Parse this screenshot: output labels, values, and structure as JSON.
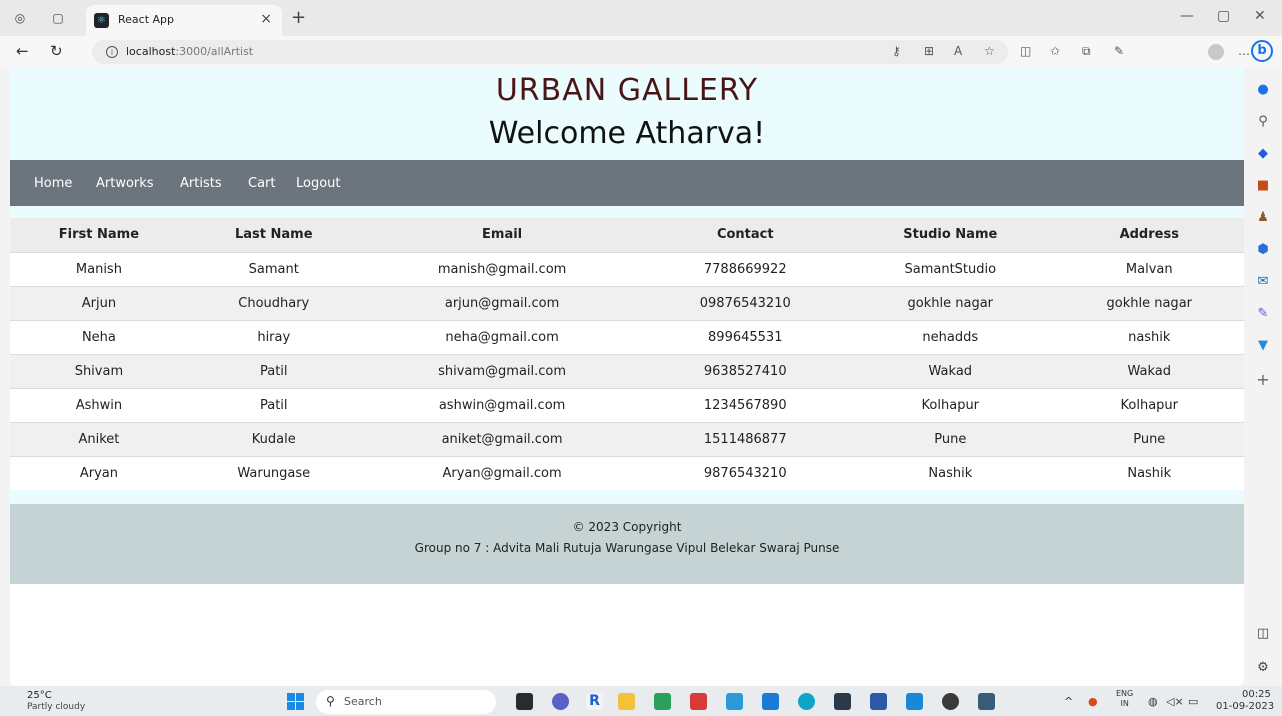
{
  "browser": {
    "tab_title": "React App",
    "url_host": "localhost",
    "url_path": ":3000/allArtist"
  },
  "page": {
    "brand": "URBAN GALLERY",
    "welcome": "Welcome Atharva!",
    "nav": [
      "Home",
      "Artworks",
      "Artists",
      "Cart",
      "Logout"
    ],
    "table": {
      "headers": [
        "First Name",
        "Last Name",
        "Email",
        "Contact",
        "Studio Name",
        "Address"
      ],
      "rows": [
        [
          "Manish",
          "Samant",
          "manish@gmail.com",
          "7788669922",
          "SamantStudio",
          "Malvan"
        ],
        [
          "Arjun",
          "Choudhary",
          "arjun@gmail.com",
          "09876543210",
          "gokhle nagar",
          "gokhle nagar"
        ],
        [
          "Neha",
          "hiray",
          "neha@gmail.com",
          "899645531",
          "nehadds",
          "nashik"
        ],
        [
          "Shivam",
          "Patil",
          "shivam@gmail.com",
          "9638527410",
          "Wakad",
          "Wakad"
        ],
        [
          "Ashwin",
          "Patil",
          "ashwin@gmail.com",
          "1234567890",
          "Kolhapur",
          "Kolhapur"
        ],
        [
          "Aniket",
          "Kudale",
          "aniket@gmail.com",
          "1511486877",
          "Pune",
          "Pune"
        ],
        [
          "Aryan",
          "Warungase",
          "Aryan@gmail.com",
          "9876543210",
          "Nashik",
          "Nashik"
        ]
      ]
    },
    "footer": {
      "copyright": "© 2023 Copyright",
      "group": "Group no 7 : Advita Mali Rutuja Warungase Vipul Belekar Swaraj Punse"
    }
  },
  "taskbar": {
    "weather_temp": "25°C",
    "weather_desc": "Partly cloudy",
    "search_placeholder": "Search",
    "lang_top": "ENG",
    "lang_bottom": "IN",
    "time": "00:25",
    "date": "01-09-2023"
  },
  "colors": {
    "hero_bg": "#eafcfd",
    "navbar_bg": "#6c757d",
    "footer_bg": "#c5d3d4",
    "brand_text": "#4a1515"
  }
}
